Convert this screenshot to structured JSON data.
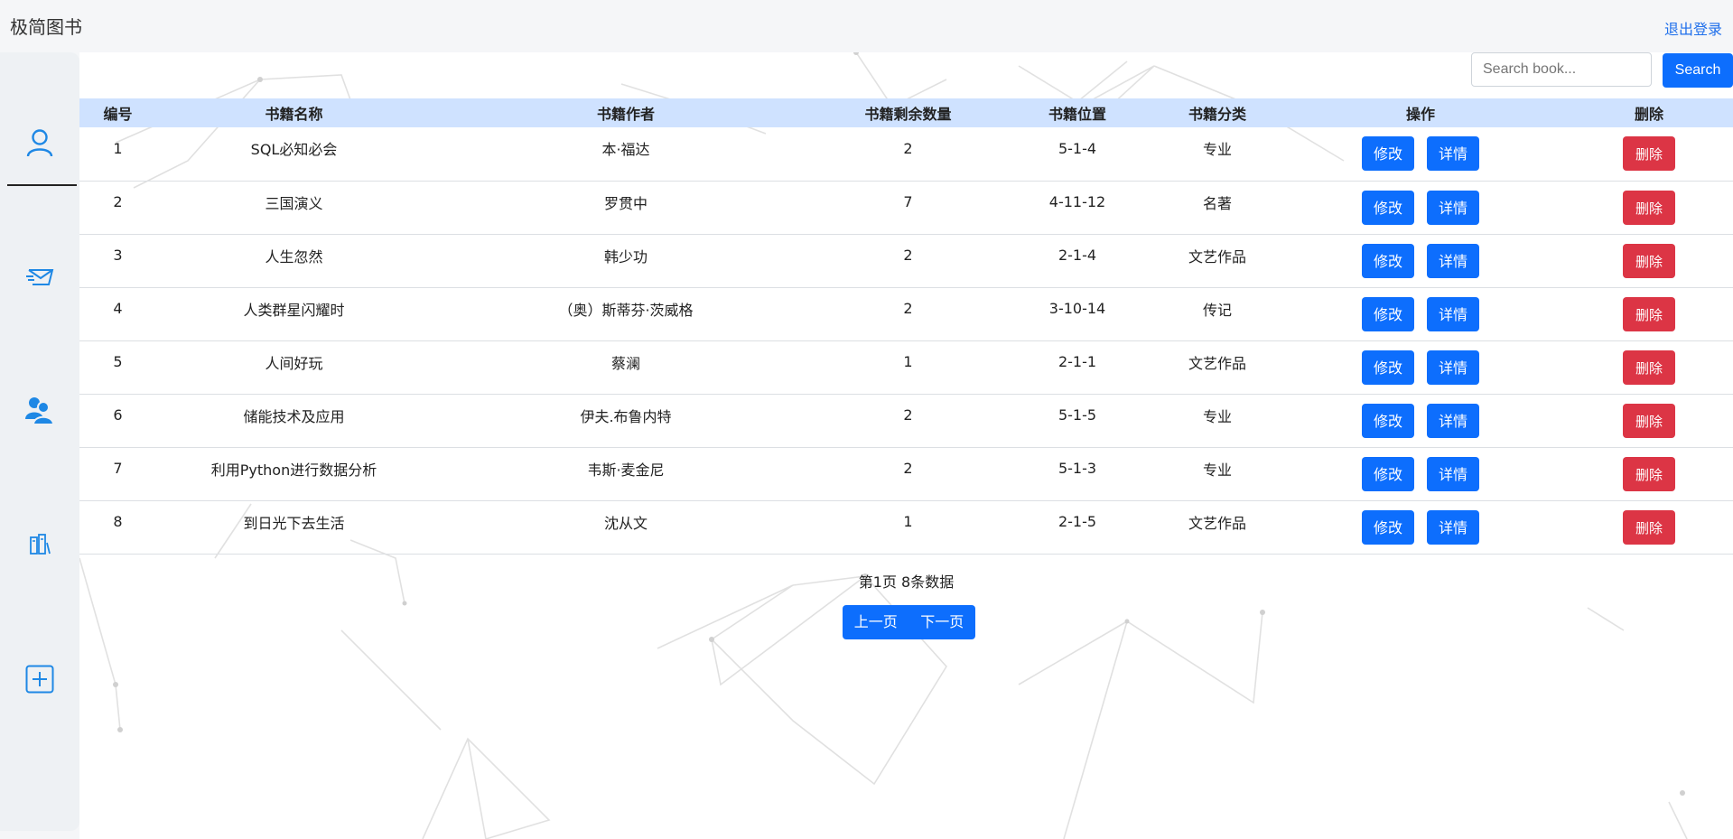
{
  "app": {
    "title": "极简图书",
    "logout": "退出登录"
  },
  "search": {
    "placeholder": "Search book...",
    "button": "Search"
  },
  "table": {
    "headers": [
      "编号",
      "书籍名称",
      "书籍作者",
      "书籍剩余数量",
      "书籍位置",
      "书籍分类",
      "操作",
      "删除"
    ],
    "edit_label": "修改",
    "detail_label": "详情",
    "delete_label": "删除",
    "rows": [
      {
        "id": "1",
        "name": "SQL必知必会",
        "author": "本·福达",
        "count": "2",
        "location": "5-1-4",
        "category": "专业"
      },
      {
        "id": "2",
        "name": "三国演义",
        "author": "罗贯中",
        "count": "7",
        "location": "4-11-12",
        "category": "名著"
      },
      {
        "id": "3",
        "name": "人生忽然",
        "author": "韩少功",
        "count": "2",
        "location": "2-1-4",
        "category": "文艺作品"
      },
      {
        "id": "4",
        "name": "人类群星闪耀时",
        "author": "（奥）斯蒂芬·茨威格",
        "count": "2",
        "location": "3-10-14",
        "category": "传记"
      },
      {
        "id": "5",
        "name": "人间好玩",
        "author": "蔡澜",
        "count": "1",
        "location": "2-1-1",
        "category": "文艺作品"
      },
      {
        "id": "6",
        "name": "储能技术及应用",
        "author": "伊夫.布鲁内特",
        "count": "2",
        "location": "5-1-5",
        "category": "专业"
      },
      {
        "id": "7",
        "name": "利用Python进行数据分析",
        "author": "韦斯·麦金尼",
        "count": "2",
        "location": "5-1-3",
        "category": "专业"
      },
      {
        "id": "8",
        "name": "到日光下去生活",
        "author": "沈从文",
        "count": "1",
        "location": "2-1-5",
        "category": "文艺作品"
      }
    ]
  },
  "pager": {
    "info": "第1页 8条数据",
    "prev": "上一页",
    "next": "下一页"
  },
  "sidebar": {
    "icons": [
      "user-icon",
      "send-mail-icon",
      "users-group-icon",
      "library-books-icon",
      "add-square-icon"
    ]
  },
  "colors": {
    "primary": "#0d6efd",
    "danger": "#dc3545",
    "header_row": "#cfe2ff",
    "icon": "#1e88e5"
  }
}
